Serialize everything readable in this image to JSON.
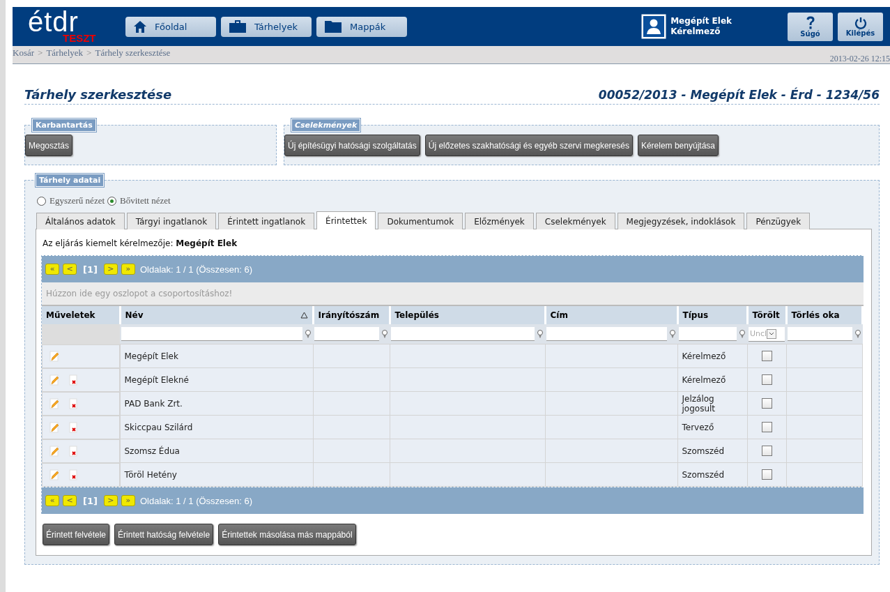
{
  "header": {
    "logo": "étdr",
    "logo_badge": "TESZT",
    "nav": [
      {
        "label": "Főoldal"
      },
      {
        "label": "Tárhelyek"
      },
      {
        "label": "Mappák"
      }
    ],
    "user": {
      "name": "Megépít Elek",
      "role": "Kérelmező"
    },
    "actions": [
      {
        "label": "Súgó"
      },
      {
        "label": "Kilépés"
      }
    ]
  },
  "breadcrumb": [
    "Kosár",
    "Tárhelyek",
    "Tárhely szerkesztése"
  ],
  "breadcrumb_separator": ">",
  "timestamp": "2013-02-26 12:15",
  "page_title": "Tárhely szerkesztése",
  "case_title": "00052/2013 - Megépít Elek - Érd - 1234/56",
  "groups": [
    {
      "legend": "Karbantartás",
      "italic": false,
      "buttons": [
        "Megosztás"
      ]
    },
    {
      "legend": "Cselekmények",
      "italic": true,
      "buttons": [
        "Új építésügyi hatósági szolgáltatás",
        "Új előzetes szakhatósági és egyéb szervi megkeresés",
        "Kérelem benyújtása"
      ]
    }
  ],
  "data_section": {
    "legend": "Tárhely adatai",
    "views": [
      {
        "label": "Egyszerű nézet",
        "selected": false
      },
      {
        "label": "Bővitett nézet",
        "selected": true
      }
    ],
    "tabs": [
      {
        "label": "Általános adatok",
        "selected": false
      },
      {
        "label": "Tárgyi ingatlanok",
        "selected": false
      },
      {
        "label": "Érintett ingatlanok",
        "selected": false
      },
      {
        "label": "Érintettek",
        "selected": true
      },
      {
        "label": "Dokumentumok",
        "selected": false
      },
      {
        "label": "Előzmények",
        "selected": false
      },
      {
        "label": "Cselekmények",
        "selected": false
      },
      {
        "label": "Megjegyzések, indoklások",
        "selected": false
      },
      {
        "label": "Pénzügyek",
        "selected": false
      }
    ],
    "lead": "Az eljárás kiemelt kérelmezője: **Megépít Elek**",
    "pagers": [
      {
        "first": "«",
        "prev": "<",
        "current": "[1]",
        "next": ">",
        "last": "»",
        "info": "Oldalak: 1 / 1 (Összesen: 6)"
      },
      {
        "first": "«",
        "prev": "<",
        "current": "[1]",
        "next": ">",
        "last": "»",
        "info": "Oldalak: 1 / 1 (Összesen: 6)"
      }
    ],
    "group_hint": "Húzzon ide egy oszlopot a csoportosításhoz!",
    "columns": [
      {
        "label": "Műveletek",
        "kind": "none",
        "sorted": false
      },
      {
        "label": "Név",
        "kind": "text",
        "sorted": true
      },
      {
        "label": "Irányítószám",
        "kind": "text",
        "sorted": false
      },
      {
        "label": "Település",
        "kind": "text",
        "sorted": false
      },
      {
        "label": "Cím",
        "kind": "text",
        "sorted": false
      },
      {
        "label": "Típus",
        "kind": "text",
        "sorted": false
      },
      {
        "label": "Törölt",
        "kind": "select",
        "sorted": false,
        "filter_value": "Uncl"
      },
      {
        "label": "Törlés oka",
        "kind": "text",
        "sorted": false
      }
    ],
    "rows": [
      {
        "name": "Megépít Elek",
        "type": "Kérelmező",
        "deletable": false,
        "deleted": false
      },
      {
        "name": "Megépít Elekné",
        "type": "Kérelmező",
        "deletable": true,
        "deleted": false
      },
      {
        "name": "PAD Bank Zrt.",
        "type": "Jelzálog jogosult",
        "deletable": true,
        "deleted": false
      },
      {
        "name": "Skiccpau Szilárd",
        "type": "Tervező",
        "deletable": true,
        "deleted": false
      },
      {
        "name": "Szomsz Édua",
        "type": "Szomszéd",
        "deletable": true,
        "deleted": false
      },
      {
        "name": "Töröl Hetény",
        "type": "Szomszéd",
        "deletable": true,
        "deleted": false
      }
    ],
    "buttons": [
      "Érintett felvétele",
      "Érintett hatóság felvétele",
      "Érintettek másolása más mappából"
    ]
  }
}
